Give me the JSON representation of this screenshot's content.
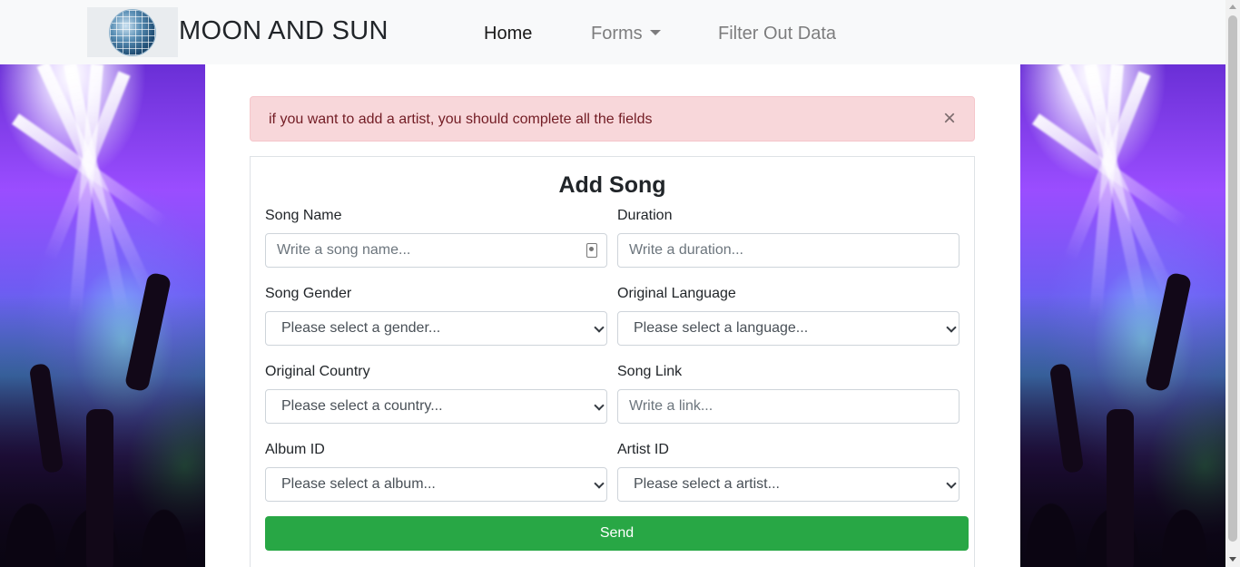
{
  "navbar": {
    "brand_name": "MOON AND SUN",
    "logo_icon": "disco-ball-icon",
    "links": [
      {
        "label": "Home",
        "active": true
      },
      {
        "label": "Forms",
        "has_dropdown": true
      },
      {
        "label": "Filter Out Data"
      }
    ]
  },
  "alert": {
    "message": "if you want to add a artist, you should complete all the fields",
    "close_symbol": "×",
    "background_color": "#f8d7da",
    "text_color": "#721c24"
  },
  "form": {
    "title": "Add Song",
    "fields": {
      "song_name": {
        "label": "Song Name",
        "placeholder": "Write a song name..."
      },
      "duration": {
        "label": "Duration",
        "placeholder": "Write a duration..."
      },
      "song_gender": {
        "label": "Song Gender",
        "selected": "Please select a gender..."
      },
      "original_language": {
        "label": "Original Language",
        "selected": "Please select a language..."
      },
      "original_country": {
        "label": "Original Country",
        "selected": "Please select a country..."
      },
      "song_link": {
        "label": "Song Link",
        "placeholder": "Write a link..."
      },
      "album_id": {
        "label": "Album ID",
        "selected": "Please select a album..."
      },
      "artist_id": {
        "label": "Artist ID",
        "selected": "Please select a artist..."
      }
    },
    "send_label": "Send",
    "send_color": "#28a745"
  }
}
